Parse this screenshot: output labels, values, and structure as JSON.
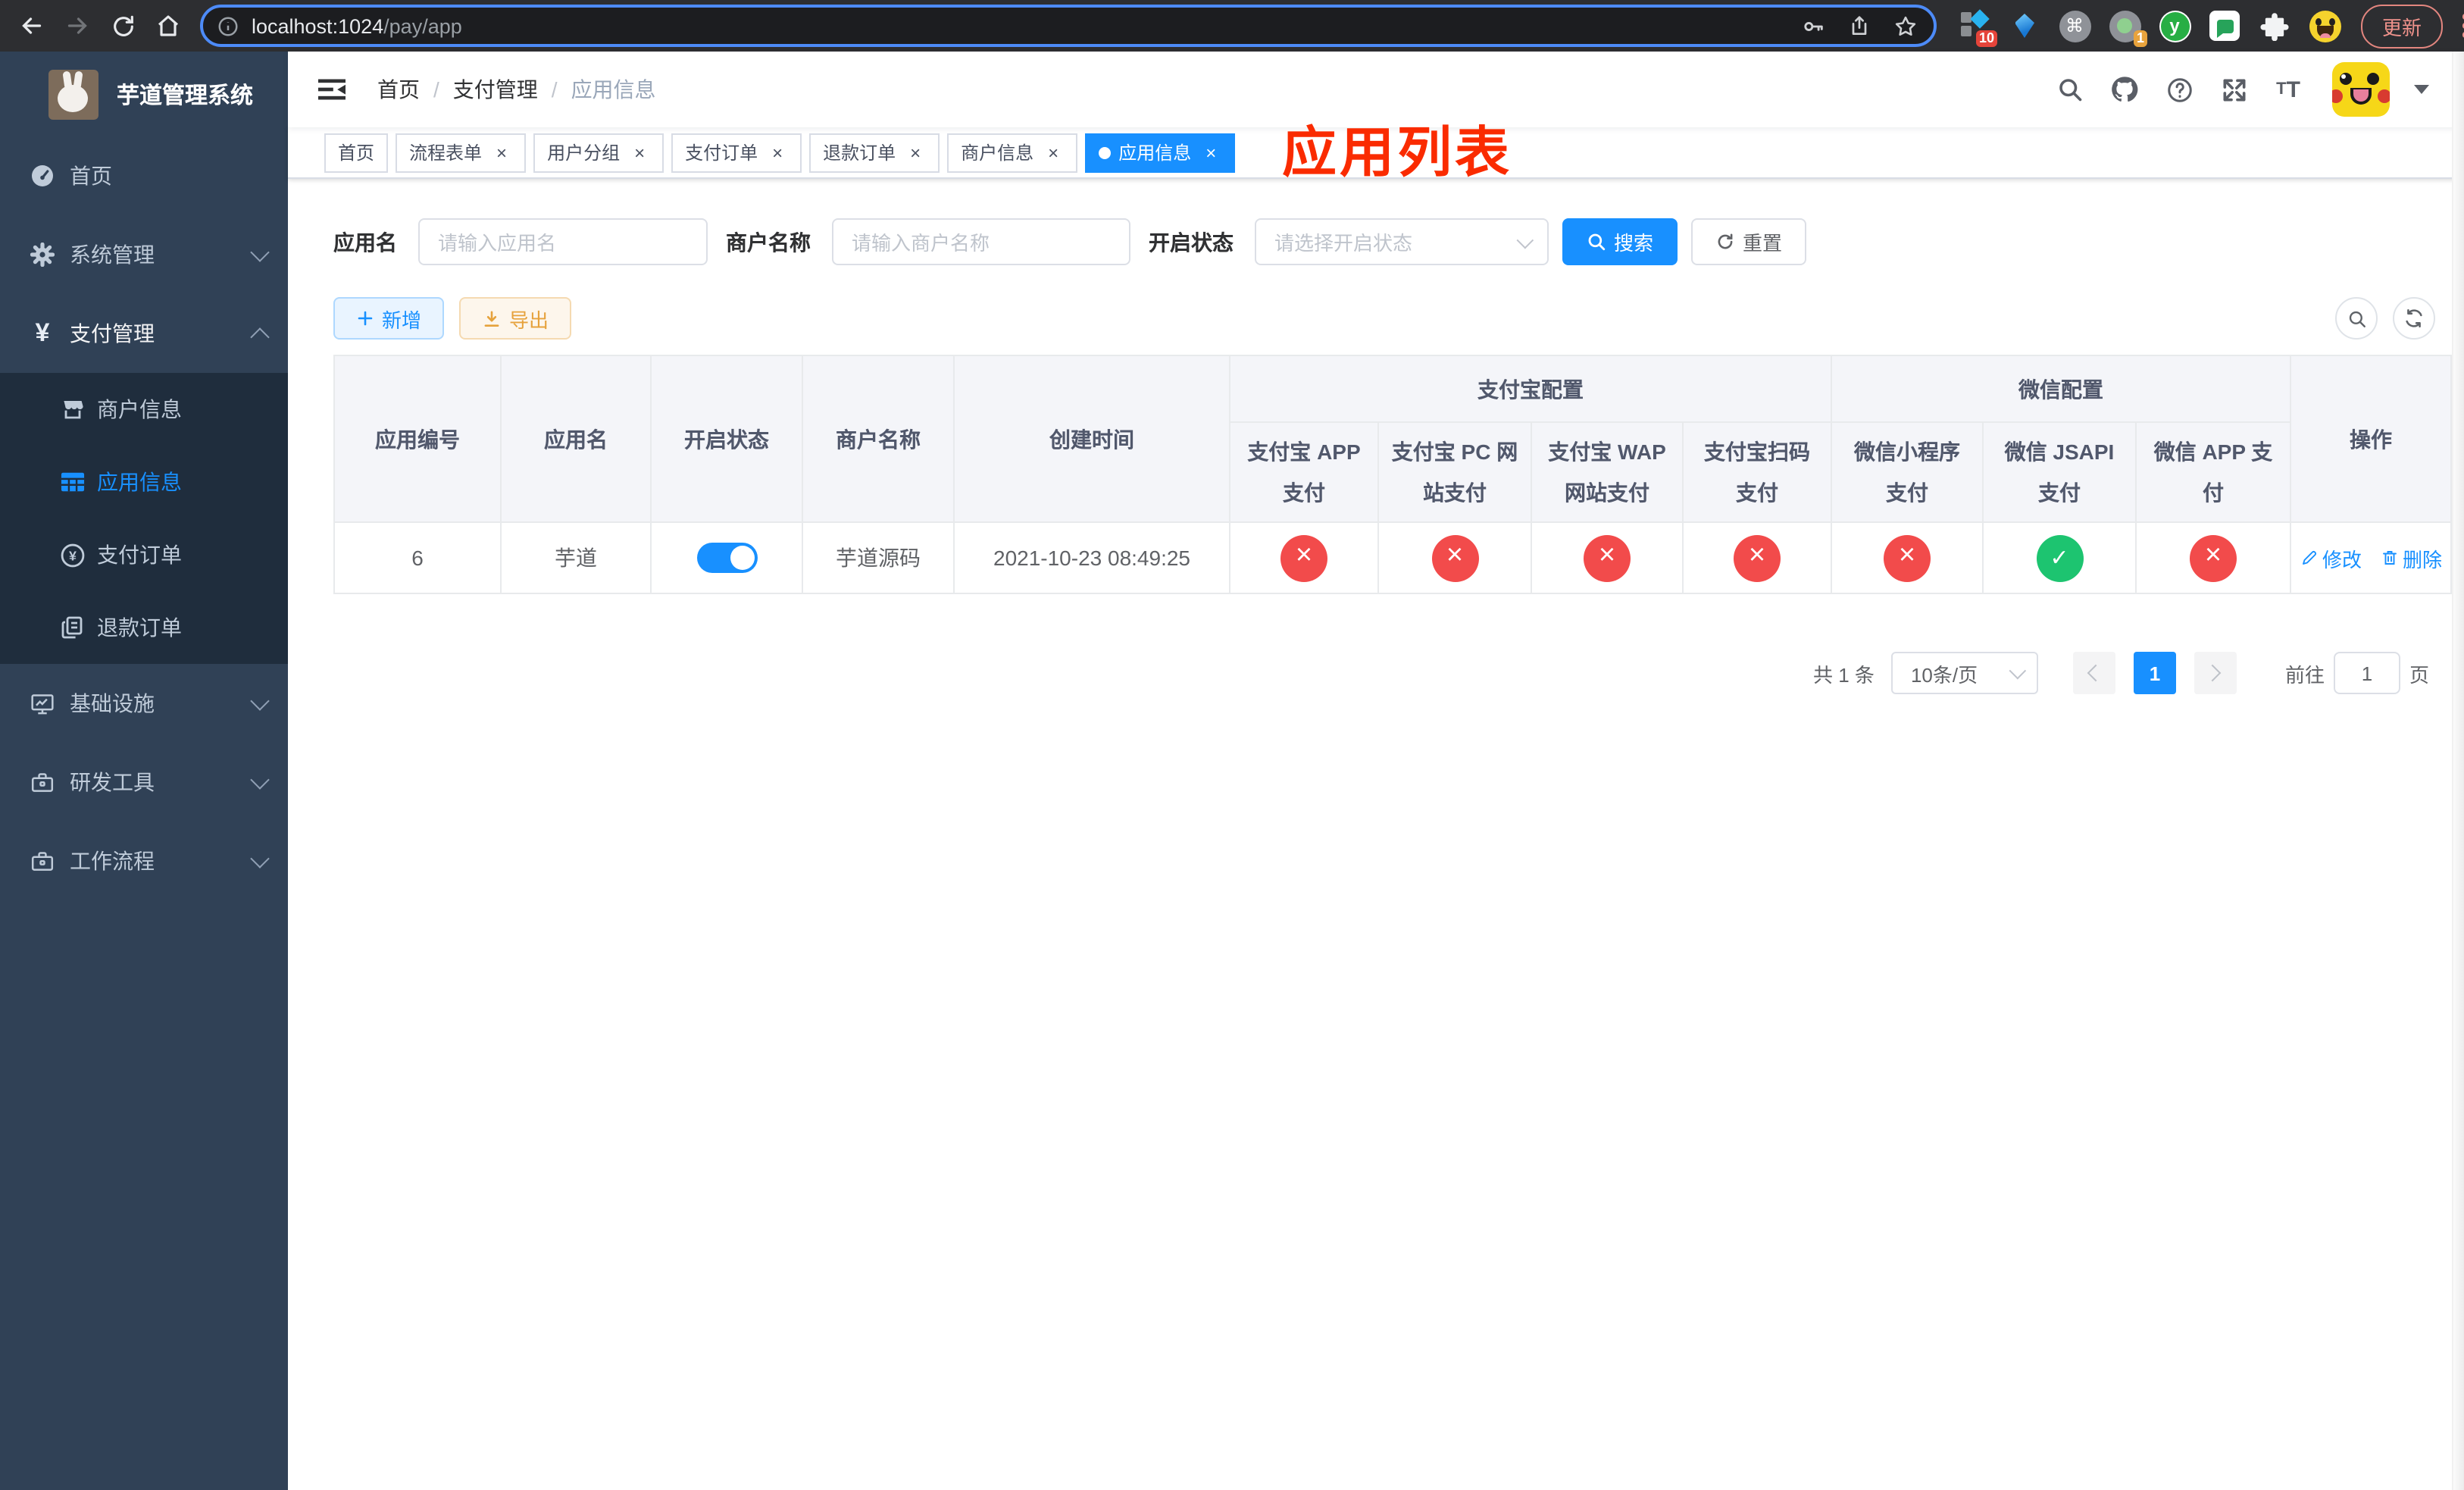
{
  "browser": {
    "url": {
      "host": "localhost:1024",
      "path": "/pay/app"
    },
    "extensions": {
      "grid_badge": "10",
      "target_badge": "1",
      "y_label": "y"
    },
    "update_label": "更新"
  },
  "sidebar": {
    "title": "芋道管理系统",
    "menu": [
      {
        "label": "首页"
      },
      {
        "label": "系统管理"
      },
      {
        "label": "支付管理"
      },
      {
        "label": "基础设施"
      },
      {
        "label": "研发工具"
      },
      {
        "label": "工作流程"
      }
    ],
    "submenu": [
      {
        "label": "商户信息"
      },
      {
        "label": "应用信息",
        "active": true
      },
      {
        "label": "支付订单"
      },
      {
        "label": "退款订单"
      }
    ]
  },
  "header": {
    "breadcrumb": [
      {
        "label": "首页"
      },
      {
        "label": "支付管理"
      },
      {
        "label": "应用信息"
      }
    ],
    "overlay_title": "应用列表"
  },
  "tabs": [
    {
      "label": "首页",
      "active": false
    },
    {
      "label": "流程表单",
      "active": false
    },
    {
      "label": "用户分组",
      "active": false
    },
    {
      "label": "支付订单",
      "active": false
    },
    {
      "label": "退款订单",
      "active": false
    },
    {
      "label": "商户信息",
      "active": false
    },
    {
      "label": "应用信息",
      "active": true
    }
  ],
  "filters": {
    "app_name": {
      "label": "应用名",
      "placeholder": "请输入应用名"
    },
    "merchant_name": {
      "label": "商户名称",
      "placeholder": "请输入商户名称"
    },
    "status": {
      "label": "开启状态",
      "placeholder": "请选择开启状态"
    },
    "search_label": "搜索",
    "reset_label": "重置"
  },
  "toolbar": {
    "add_label": "新增",
    "export_label": "导出"
  },
  "table": {
    "plain_columns": [
      "应用编号",
      "应用名",
      "开启状态",
      "商户名称",
      "创建时间"
    ],
    "group_alipay": {
      "label": "支付宝配置",
      "columns": [
        "支付宝 APP 支付",
        "支付宝 PC 网站支付",
        "支付宝 WAP 网站支付",
        "支付宝扫码支付"
      ]
    },
    "group_wechat": {
      "label": "微信配置",
      "columns": [
        "微信小程序支付",
        "微信 JSAPI 支付",
        "微信 APP 支付"
      ]
    },
    "ops_column": "操作",
    "rows": [
      {
        "id": "6",
        "name": "芋道",
        "enabled": true,
        "merchant": "芋道源码",
        "created_at": "2021-10-23 08:49:25",
        "channel_status": [
          "closed",
          "closed",
          "closed",
          "closed",
          "closed",
          "open",
          "closed"
        ],
        "actions": {
          "edit": "修改",
          "delete": "删除"
        }
      }
    ]
  },
  "pagination": {
    "total": "共 1 条",
    "page_size": "10条/页",
    "current_page": "1",
    "goto_label": "前往",
    "goto_value": "1",
    "unit_label": "页"
  },
  "colors": {
    "primary": "#1890ff",
    "danger": "#f24b4b",
    "success": "#1dc470",
    "warning": "#e6a23c",
    "overlay_title_red": "#fa2b00",
    "sidebar_bg": "#304156",
    "submenu_bg": "#1f2d3d"
  }
}
